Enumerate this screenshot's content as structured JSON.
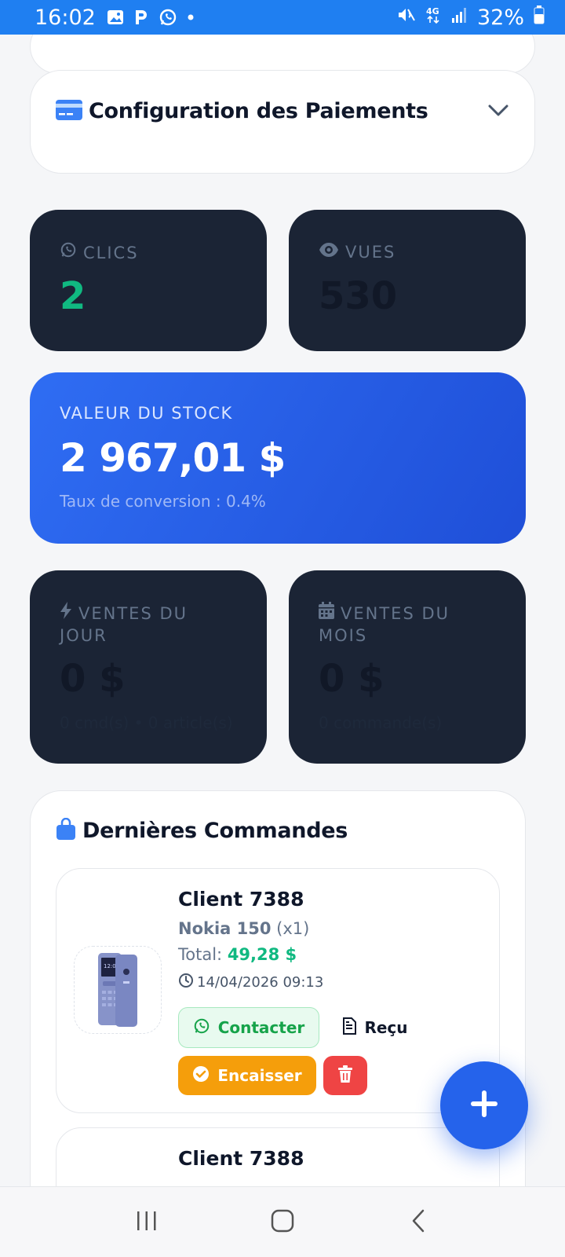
{
  "status_bar": {
    "time": "16:02",
    "battery": "32%",
    "left_icons": [
      "gallery-icon",
      "parking-icon",
      "whatsapp-icon",
      "dot-icon"
    ],
    "right_icons": [
      "mute-icon",
      "4g-icon",
      "signal-icon",
      "battery-icon"
    ]
  },
  "config": {
    "title": "Configuration des Paiements",
    "icon": "credit-card-icon"
  },
  "stats": {
    "clics": {
      "label": "CLICS",
      "value": "2",
      "icon": "whatsapp-icon"
    },
    "vues": {
      "label": "VUES",
      "value": "530",
      "icon": "eye-icon"
    }
  },
  "stock": {
    "label": "VALEUR DU STOCK",
    "value": "2 967,01 $",
    "subtitle": "Taux de conversion : 0.4%"
  },
  "sales": {
    "jour": {
      "label_line1": "VENTES DU",
      "label_line2": "JOUR",
      "value": "0 $",
      "sub": "0 cmd(s) • 0 article(s)",
      "icon": "bolt-icon"
    },
    "mois": {
      "label_line1": "VENTES DU",
      "label_line2": "MOIS",
      "value": "0 $",
      "sub": "0 commande(s)",
      "icon": "calendar-icon"
    }
  },
  "orders": {
    "title": "Dernières Commandes",
    "icon": "shopping-bag-icon",
    "items": [
      {
        "client": "Client 7388",
        "product": "Nokia 150",
        "qty": "(x1)",
        "total_label": "Total:",
        "total_value": "49,28 $",
        "date": "14/04/2026 09:13",
        "actions": {
          "contact": "Contacter",
          "receipt": "Reçu",
          "cash": "Encaisser"
        }
      },
      {
        "client": "Client 7388"
      }
    ]
  },
  "colors": {
    "accent": "#2563eb",
    "status_bar": "#1f7ff1",
    "dark_card": "#1b2435",
    "success": "#10b981",
    "warning": "#f59e0b",
    "danger": "#ef4444"
  }
}
